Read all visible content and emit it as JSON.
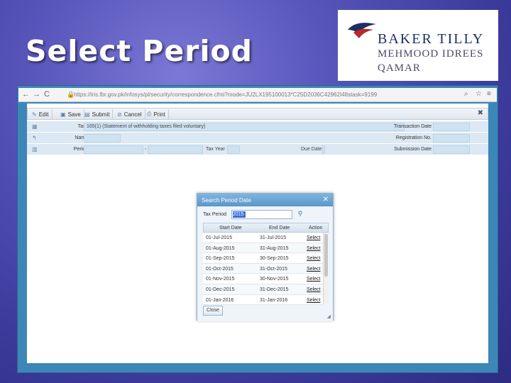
{
  "slide": {
    "title": "Select Period"
  },
  "logo": {
    "line1": "BAKER TILLY",
    "line2": "MEHMOOD IDREES",
    "line3": "QAMAR"
  },
  "browser": {
    "url": "https://iris.fbr.gov.pk/infosys/pl/security/correspondence.cfmi?mode=JU2LX195100013*C25D2036C42962I48stask=9199"
  },
  "toolbar": {
    "edit": "Edit",
    "save": "Save",
    "submit": "Submit",
    "cancel": "Cancel",
    "print": "Print"
  },
  "form": {
    "task_label": "Task",
    "task_value": "165(1) (Statement of withholding taxes filed voluntary)",
    "name_label": "Name",
    "period_label": "Period",
    "period_sep": "-",
    "tax_year_label": "Tax Year",
    "due_date_label": "Due Date",
    "transaction_date_label": "Transaction Date",
    "registration_no_label": "Registration No.",
    "submission_date_label": "Submission Date"
  },
  "dialog": {
    "title": "Search Period Date",
    "tax_period_label": "Tax Period",
    "tax_period_value": "2015",
    "columns": {
      "start": "Start Date",
      "end": "End Date",
      "action": "Action"
    },
    "rows": [
      {
        "start": "01-Jul-2015",
        "end": "31-Jul-2015",
        "action": "Select"
      },
      {
        "start": "01-Aug-2015",
        "end": "31-Aug-2015",
        "action": "Select"
      },
      {
        "start": "01-Sep-2015",
        "end": "30-Sep-2015",
        "action": "Select"
      },
      {
        "start": "01-Oct-2015",
        "end": "31-Oct-2015",
        "action": "Select"
      },
      {
        "start": "01-Nov-2015",
        "end": "30-Nov-2015",
        "action": "Select"
      },
      {
        "start": "01-Dec-2015",
        "end": "31-Dec-2015",
        "action": "Select"
      },
      {
        "start": "01-Jan-2016",
        "end": "31-Jan-2016",
        "action": "Select"
      }
    ],
    "close_label": "Close"
  }
}
